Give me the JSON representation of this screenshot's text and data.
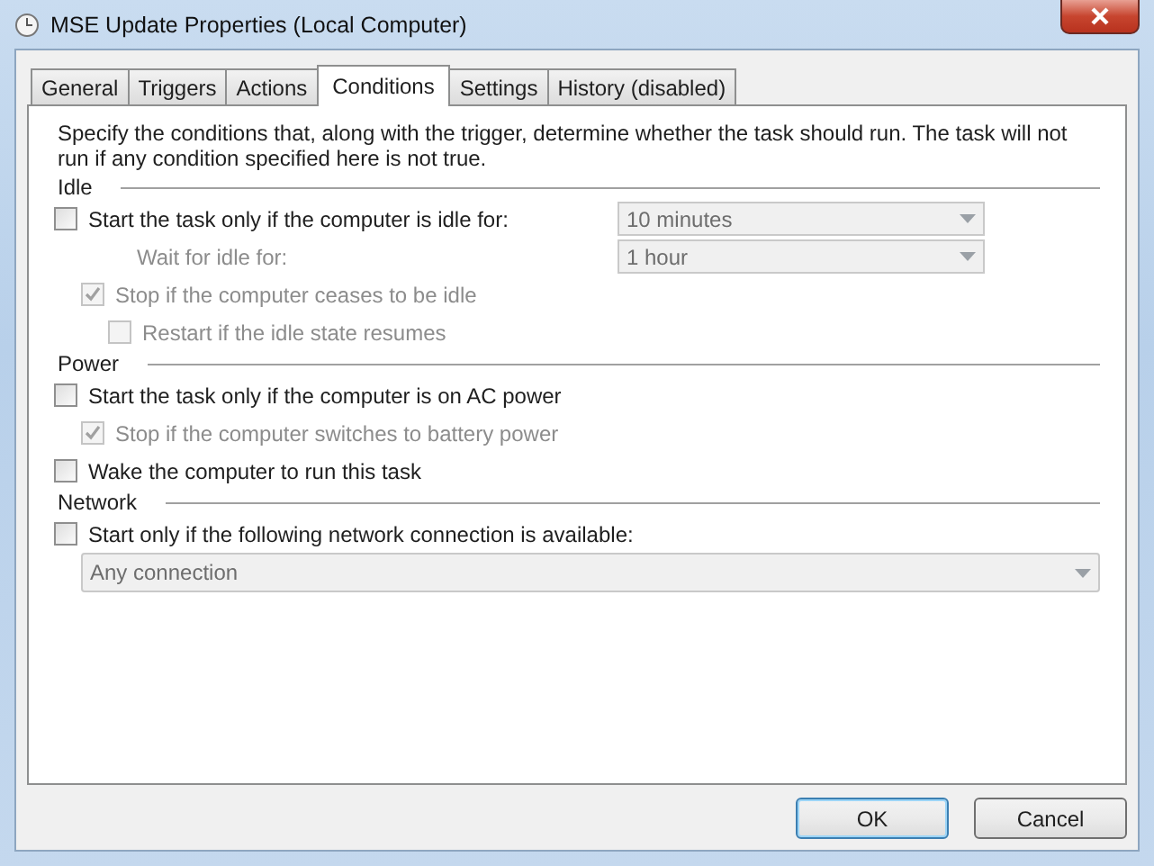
{
  "window": {
    "title": "MSE Update Properties (Local Computer)"
  },
  "tabs": [
    {
      "label": "General",
      "selected": false
    },
    {
      "label": "Triggers",
      "selected": false
    },
    {
      "label": "Actions",
      "selected": false
    },
    {
      "label": "Conditions",
      "selected": true
    },
    {
      "label": "Settings",
      "selected": false
    },
    {
      "label": "History (disabled)",
      "selected": false
    }
  ],
  "description": "Specify the conditions that, along with the trigger, determine whether the task should run.  The task will not run  if any condition specified here is not true.",
  "sections": [
    {
      "title": "Idle",
      "items": [
        {
          "kind": "checkbox",
          "label": "Start the task only if the computer is idle for:",
          "checked": false,
          "disabled": false,
          "dropdown": {
            "value": "10 minutes",
            "disabled": true
          },
          "children": [
            {
              "kind": "field",
              "label": "Wait for idle for:",
              "disabled": true,
              "dropdown": {
                "value": "1 hour",
                "disabled": true
              }
            },
            {
              "kind": "checkbox",
              "label": "Stop if the computer ceases to be idle",
              "checked": true,
              "disabled": true,
              "children": [
                {
                  "kind": "checkbox",
                  "label": "Restart if the idle state resumes",
                  "checked": false,
                  "disabled": true
                }
              ]
            }
          ]
        }
      ]
    },
    {
      "title": "Power",
      "items": [
        {
          "kind": "checkbox",
          "label": "Start the task only if the computer is on AC power",
          "checked": false,
          "disabled": false,
          "children": [
            {
              "kind": "checkbox",
              "label": "Stop if the computer switches to battery power",
              "checked": true,
              "disabled": true
            }
          ]
        },
        {
          "kind": "checkbox",
          "label": "Wake the computer to run this task",
          "checked": false,
          "disabled": false
        }
      ]
    },
    {
      "title": "Network",
      "items": [
        {
          "kind": "checkbox",
          "label": "Start only if the following network connection is available:",
          "checked": false,
          "disabled": false,
          "children": [
            {
              "kind": "dropdown",
              "dropdown": {
                "value": "Any connection",
                "disabled": true
              }
            }
          ]
        }
      ]
    }
  ],
  "buttons": [
    {
      "label": "OK",
      "default": true
    },
    {
      "label": "Cancel",
      "default": false
    }
  ]
}
